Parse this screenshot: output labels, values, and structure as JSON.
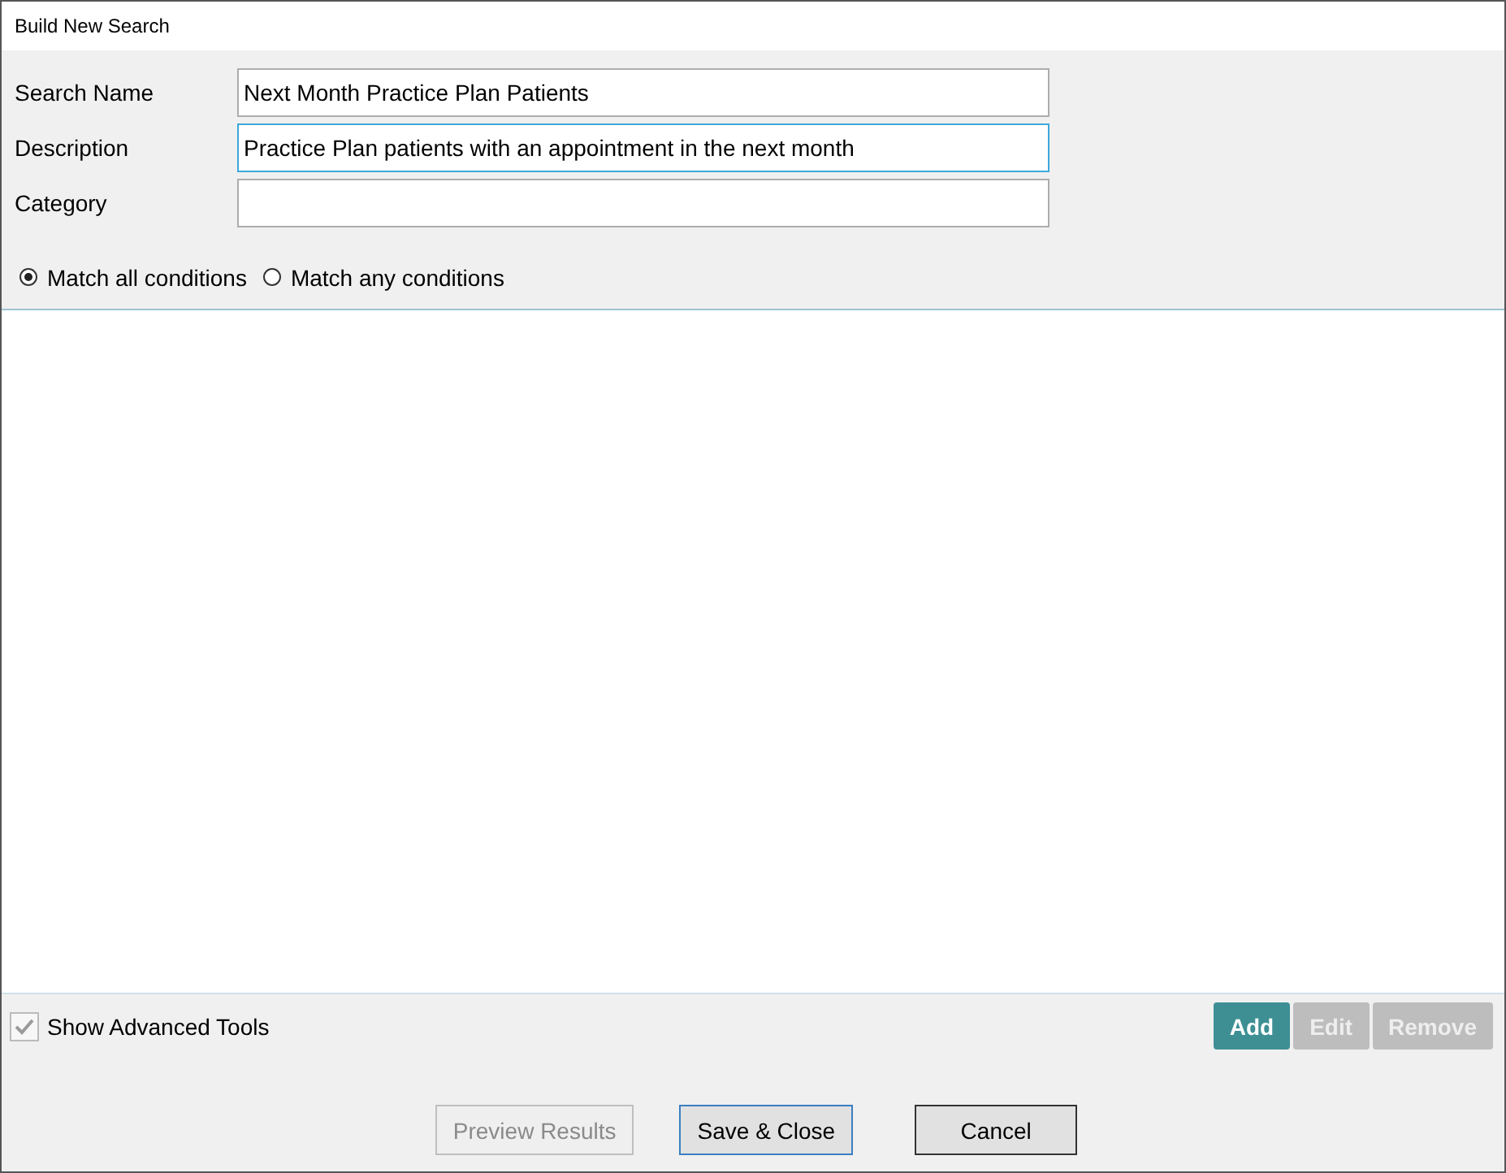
{
  "window": {
    "title": "Build New Search"
  },
  "fields": [
    {
      "label": "Search Name",
      "value": "Next Month Practice Plan Patients",
      "focused": false
    },
    {
      "label": "Description",
      "value": "Practice Plan patients with an appointment in the next month",
      "focused": true
    },
    {
      "label": "Category",
      "focused": false
    }
  ],
  "match_options": [
    {
      "label": "Match all conditions",
      "selected": true
    },
    {
      "label": "Match any conditions",
      "selected": false
    }
  ],
  "show_advanced_tools": {
    "label": "Show Advanced Tools",
    "checked": true,
    "disabled": true
  },
  "condition_buttons": [
    {
      "label": "Add",
      "disabled": false
    },
    {
      "label": "Edit",
      "disabled": true
    },
    {
      "label": "Remove",
      "disabled": true
    }
  ],
  "footer_buttons": [
    {
      "label": "Preview Results",
      "disabled": true,
      "focused": false
    },
    {
      "label": "Save & Close",
      "disabled": false,
      "focused": true
    },
    {
      "label": "Cancel",
      "disabled": false,
      "focused": false
    }
  ]
}
